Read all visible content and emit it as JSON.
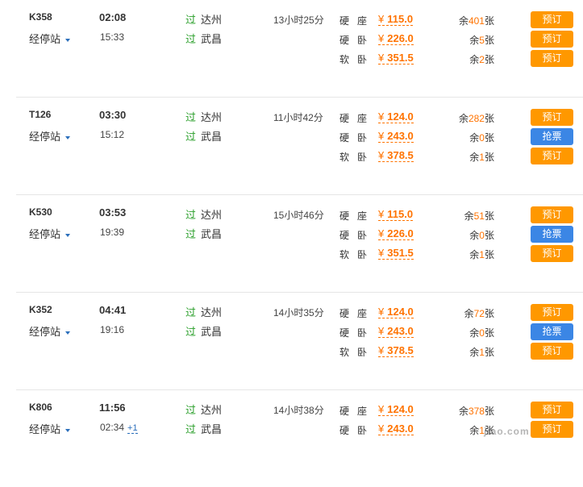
{
  "accent_colors": {
    "price": "#ff7300",
    "book": "#ff9800",
    "grab": "#3b86e5",
    "pass": "#2ca02c"
  },
  "trains": [
    {
      "no": "K358",
      "stops_label": "经停站",
      "dep": "02:08",
      "arr": "15:33",
      "arr_plus": "",
      "from_tag": "过",
      "from": "达州",
      "to_tag": "过",
      "to": "武昌",
      "duration": "13小时25分",
      "seats": [
        {
          "type": "硬座",
          "yen": "¥",
          "price": "115.0",
          "pre": "余",
          "num": "401",
          "post": "张",
          "action": "预订",
          "kind": "book"
        },
        {
          "type": "硬卧",
          "yen": "¥",
          "price": "226.0",
          "pre": "余",
          "num": "5",
          "post": "张",
          "action": "预订",
          "kind": "book"
        },
        {
          "type": "软卧",
          "yen": "¥",
          "price": "351.5",
          "pre": "余",
          "num": "2",
          "post": "张",
          "action": "预订",
          "kind": "book"
        }
      ]
    },
    {
      "no": "T126",
      "stops_label": "经停站",
      "dep": "03:30",
      "arr": "15:12",
      "arr_plus": "",
      "from_tag": "过",
      "from": "达州",
      "to_tag": "过",
      "to": "武昌",
      "duration": "11小时42分",
      "seats": [
        {
          "type": "硬座",
          "yen": "¥",
          "price": "124.0",
          "pre": "余",
          "num": "282",
          "post": "张",
          "action": "预订",
          "kind": "book"
        },
        {
          "type": "硬卧",
          "yen": "¥",
          "price": "243.0",
          "pre": "余",
          "num": "0",
          "post": "张",
          "action": "抢票",
          "kind": "grab"
        },
        {
          "type": "软卧",
          "yen": "¥",
          "price": "378.5",
          "pre": "余",
          "num": "1",
          "post": "张",
          "action": "预订",
          "kind": "book"
        }
      ]
    },
    {
      "no": "K530",
      "stops_label": "经停站",
      "dep": "03:53",
      "arr": "19:39",
      "arr_plus": "",
      "from_tag": "过",
      "from": "达州",
      "to_tag": "过",
      "to": "武昌",
      "duration": "15小时46分",
      "seats": [
        {
          "type": "硬座",
          "yen": "¥",
          "price": "115.0",
          "pre": "余",
          "num": "51",
          "post": "张",
          "action": "预订",
          "kind": "book"
        },
        {
          "type": "硬卧",
          "yen": "¥",
          "price": "226.0",
          "pre": "余",
          "num": "0",
          "post": "张",
          "action": "抢票",
          "kind": "grab"
        },
        {
          "type": "软卧",
          "yen": "¥",
          "price": "351.5",
          "pre": "余",
          "num": "1",
          "post": "张",
          "action": "预订",
          "kind": "book"
        }
      ]
    },
    {
      "no": "K352",
      "stops_label": "经停站",
      "dep": "04:41",
      "arr": "19:16",
      "arr_plus": "",
      "from_tag": "过",
      "from": "达州",
      "to_tag": "过",
      "to": "武昌",
      "duration": "14小时35分",
      "seats": [
        {
          "type": "硬座",
          "yen": "¥",
          "price": "124.0",
          "pre": "余",
          "num": "72",
          "post": "张",
          "action": "预订",
          "kind": "book"
        },
        {
          "type": "硬卧",
          "yen": "¥",
          "price": "243.0",
          "pre": "余",
          "num": "0",
          "post": "张",
          "action": "抢票",
          "kind": "grab"
        },
        {
          "type": "软卧",
          "yen": "¥",
          "price": "378.5",
          "pre": "余",
          "num": "1",
          "post": "张",
          "action": "预订",
          "kind": "book"
        }
      ]
    },
    {
      "no": "K806",
      "stops_label": "经停站",
      "dep": "11:56",
      "arr": "02:34",
      "arr_plus": "+1",
      "from_tag": "过",
      "from": "达州",
      "to_tag": "过",
      "to": "武昌",
      "duration": "14小时38分",
      "seats": [
        {
          "type": "硬座",
          "yen": "¥",
          "price": "124.0",
          "pre": "余",
          "num": "378",
          "post": "张",
          "action": "预订",
          "kind": "book"
        },
        {
          "type": "硬卧",
          "yen": "¥",
          "price": "243.0",
          "pre": "余",
          "num": "1",
          "post": "张",
          "action": "预订",
          "kind": "book"
        }
      ]
    }
  ],
  "watermark": "jiao.com"
}
